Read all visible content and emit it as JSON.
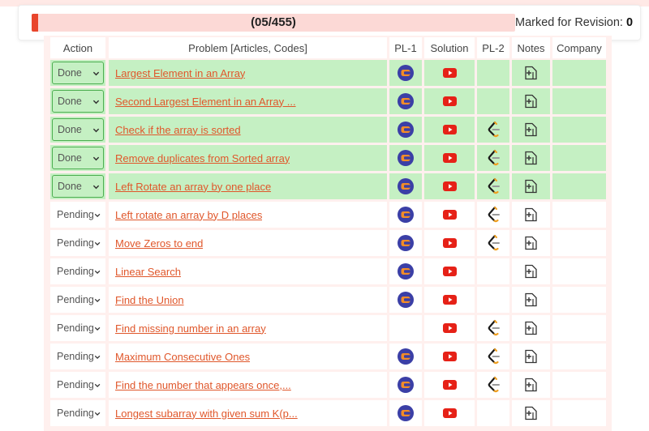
{
  "progress": {
    "text": "(05/455)",
    "completed": 5,
    "total": 455,
    "revision_label": "Marked for Revision: ",
    "revision_count": "0"
  },
  "columns": {
    "action": "Action",
    "problem": "Problem [Articles, Codes]",
    "pl1": "PL-1",
    "solution": "Solution",
    "pl2": "PL-2",
    "notes": "Notes",
    "company": "Company"
  },
  "colors": {
    "accent": "#e8452c",
    "done_bg": "#c5f0c3",
    "link": "#e0572b",
    "youtube": "#e62117",
    "codingninjas": "#3b3fa6"
  },
  "rows": [
    {
      "status": "Done",
      "title": "Largest Element in an Array",
      "pl1": true,
      "pl2": false
    },
    {
      "status": "Done",
      "title": "Second Largest Element in an Array ...",
      "pl1": true,
      "pl2": false
    },
    {
      "status": "Done",
      "title": "Check if the array is sorted",
      "pl1": true,
      "pl2": true
    },
    {
      "status": "Done",
      "title": "Remove duplicates from Sorted array",
      "pl1": true,
      "pl2": true
    },
    {
      "status": "Done",
      "title": "Left Rotate an array by one place",
      "pl1": true,
      "pl2": true
    },
    {
      "status": "Pending",
      "title": "Left rotate an array by D places",
      "pl1": true,
      "pl2": true
    },
    {
      "status": "Pending",
      "title": "Move Zeros to end",
      "pl1": true,
      "pl2": true
    },
    {
      "status": "Pending",
      "title": "Linear Search",
      "pl1": true,
      "pl2": false
    },
    {
      "status": "Pending",
      "title": "Find the Union",
      "pl1": true,
      "pl2": false
    },
    {
      "status": "Pending",
      "title": "Find missing number in an array",
      "pl1": false,
      "pl2": true
    },
    {
      "status": "Pending",
      "title": "Maximum Consecutive Ones",
      "pl1": true,
      "pl2": true
    },
    {
      "status": "Pending",
      "title": "Find the number that appears once,...",
      "pl1": true,
      "pl2": true
    },
    {
      "status": "Pending",
      "title": "Longest subarray with given sum K(p...",
      "pl1": true,
      "pl2": false
    }
  ]
}
